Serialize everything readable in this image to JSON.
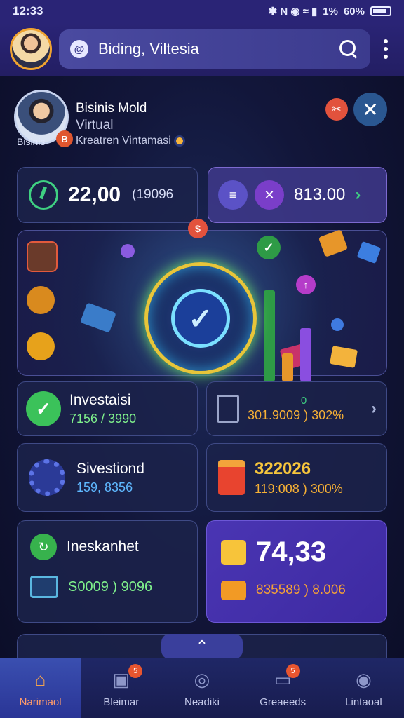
{
  "status": {
    "time": "12:33",
    "icons": "✱ N ◉ ≈ ▮",
    "battery_pct1": "1%",
    "battery_pct2": "60%"
  },
  "app_bar": {
    "search_value": "Biding, Viltesia",
    "search_pin": "@"
  },
  "profile": {
    "name": "Bisinis Mold",
    "role": "Virtual",
    "subtitle": "Kreatren Vintamasi",
    "handle": "Bisinis",
    "badge": "B",
    "action_icon": "✂",
    "close_icon": "✕"
  },
  "balance": {
    "main": "22,00",
    "sub": "(19096"
  },
  "wallet": {
    "icon1": "≡",
    "icon2": "✕",
    "value": "813.00",
    "chevron": "›"
  },
  "hero": {
    "check": "✓",
    "icons": {
      "top": "$",
      "left_mid": "✓",
      "right_top": "✓",
      "right_mid": "↑"
    }
  },
  "invest": {
    "title": "Investaisi",
    "value": "7156 / 3990"
  },
  "calc": {
    "value": "301.9009 ) 302%",
    "icon_label": "0"
  },
  "card2a": {
    "title": "Sivestiond",
    "value": "159, 8356"
  },
  "card2b": {
    "title": "322026",
    "value": "119:008 ) 300%"
  },
  "card3a": {
    "title": "Ineskanhet",
    "value": "S0009 ) 9096"
  },
  "card3b": {
    "title": "74,33",
    "value": "835589 ) 8.006"
  },
  "collapse": {
    "icon": "⌃"
  },
  "nav": [
    {
      "label": "Narimaol",
      "icon": "⌂"
    },
    {
      "label": "Bleimar",
      "icon": "▣",
      "badge": "5"
    },
    {
      "label": "Neadiki",
      "icon": "◎"
    },
    {
      "label": "Greaeeds",
      "icon": "▭",
      "badge": "5"
    },
    {
      "label": "Lintaoal",
      "icon": "◉"
    }
  ]
}
